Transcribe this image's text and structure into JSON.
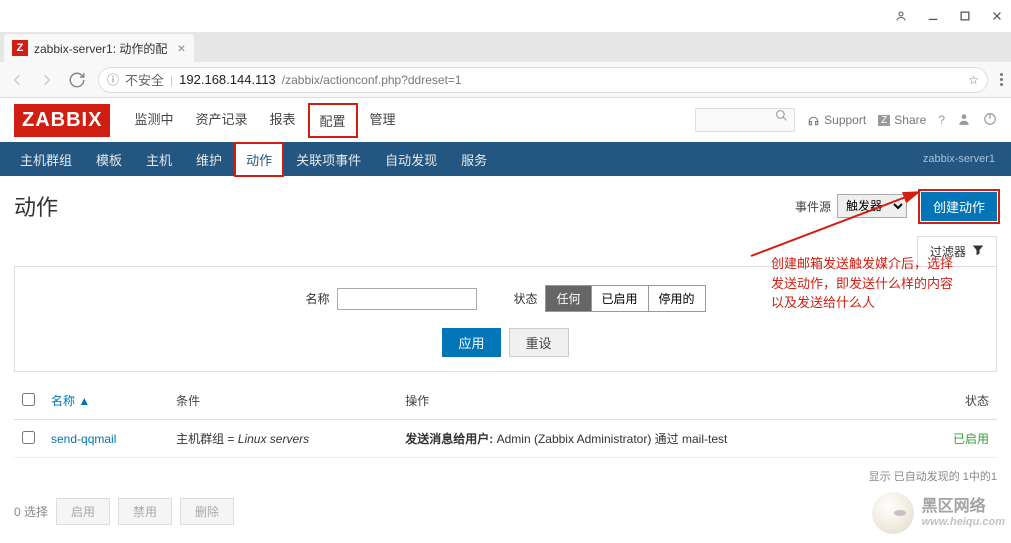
{
  "window": {
    "tab_title": "zabbix-server1: 动作的配",
    "favicon_letter": "Z"
  },
  "url": {
    "warn_label": "不安全",
    "host": "192.168.144.113",
    "path": "/zabbix/actionconf.php?ddreset=1"
  },
  "header": {
    "logo": "ZABBIX",
    "nav": [
      "监测中",
      "资产记录",
      "报表",
      "配置",
      "管理"
    ],
    "support": "Support",
    "share": "Share"
  },
  "subnav": {
    "items": [
      "主机群组",
      "模板",
      "主机",
      "维护",
      "动作",
      "关联项事件",
      "自动发现",
      "服务"
    ],
    "server": "zabbix-server1"
  },
  "page": {
    "title": "动作",
    "event_source_label": "事件源",
    "event_source_value": "触发器",
    "create_btn": "创建动作",
    "filter_tab": "过滤器"
  },
  "filter": {
    "name_label": "名称",
    "status_label": "状态",
    "status_any": "任何",
    "status_enabled": "已启用",
    "status_disabled": "停用的",
    "apply": "应用",
    "reset": "重设"
  },
  "annotation": {
    "line1": "创建邮箱发送触发媒介后，选择",
    "line2": "发送动作，即发送什么样的内容",
    "line3": "以及发送给什么人"
  },
  "table": {
    "cols": {
      "name": "名称 ▲",
      "condition": "条件",
      "operation": "操作",
      "status": "状态"
    },
    "rows": [
      {
        "name": "send-qqmail",
        "condition_prefix": "主机群组 = ",
        "condition_italic": "Linux servers",
        "op_bold": "发送消息给用户:",
        "op_rest": " Admin (Zabbix Administrator) 通过 mail-test",
        "status": "已启用"
      }
    ],
    "footer": "显示 已自动发现的 1中的1"
  },
  "bulk": {
    "selected": "0 选择",
    "enable": "启用",
    "disable": "禁用",
    "delete": "删除"
  },
  "watermark": {
    "title": "黑区网络",
    "sub": "www.heiqu.com"
  }
}
